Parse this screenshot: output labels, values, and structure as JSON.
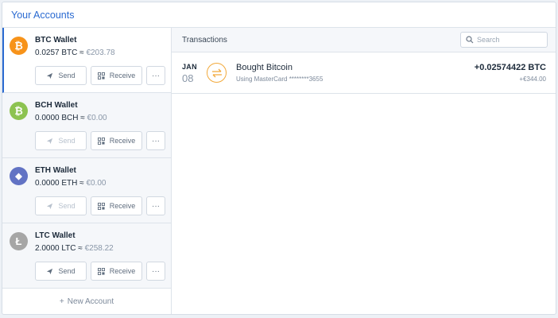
{
  "header": {
    "title": "Your Accounts"
  },
  "wallets": [
    {
      "name": "BTC Wallet",
      "balance": "0.0257 BTC",
      "approx": "≈",
      "fiat": "€203.78",
      "coin_color": "#f7931a",
      "icon": "bitcoin-icon",
      "glyph": "₿",
      "active": true,
      "actions_enabled": true
    },
    {
      "name": "BCH Wallet",
      "balance": "0.0000 BCH",
      "approx": "≈",
      "fiat": "€0.00",
      "coin_color": "#8dc351",
      "icon": "bitcoin-cash-icon",
      "glyph": "₿",
      "active": false,
      "actions_enabled": false
    },
    {
      "name": "ETH Wallet",
      "balance": "0.0000 ETH",
      "approx": "≈",
      "fiat": "€0.00",
      "coin_color": "#6273c4",
      "icon": "ethereum-icon",
      "glyph": "◆",
      "active": false,
      "actions_enabled": false
    },
    {
      "name": "LTC Wallet",
      "balance": "2.0000 LTC",
      "approx": "≈",
      "fiat": "€258.22",
      "coin_color": "#a6a6a6",
      "icon": "litecoin-icon",
      "glyph": "Ł",
      "active": false,
      "actions_enabled": true
    }
  ],
  "buttons": {
    "send": "Send",
    "receive": "Receive",
    "more": "···"
  },
  "new_account": {
    "label": "New Account",
    "plus": "+"
  },
  "transactions": {
    "title": "Transactions",
    "search_placeholder": "Search",
    "rows": [
      {
        "month": "JAN",
        "day": "08",
        "label": "Bought Bitcoin",
        "sub": "Using MasterCard ********3655",
        "amount": "+0.02574422 BTC",
        "fiat": "+€344.00"
      }
    ]
  }
}
